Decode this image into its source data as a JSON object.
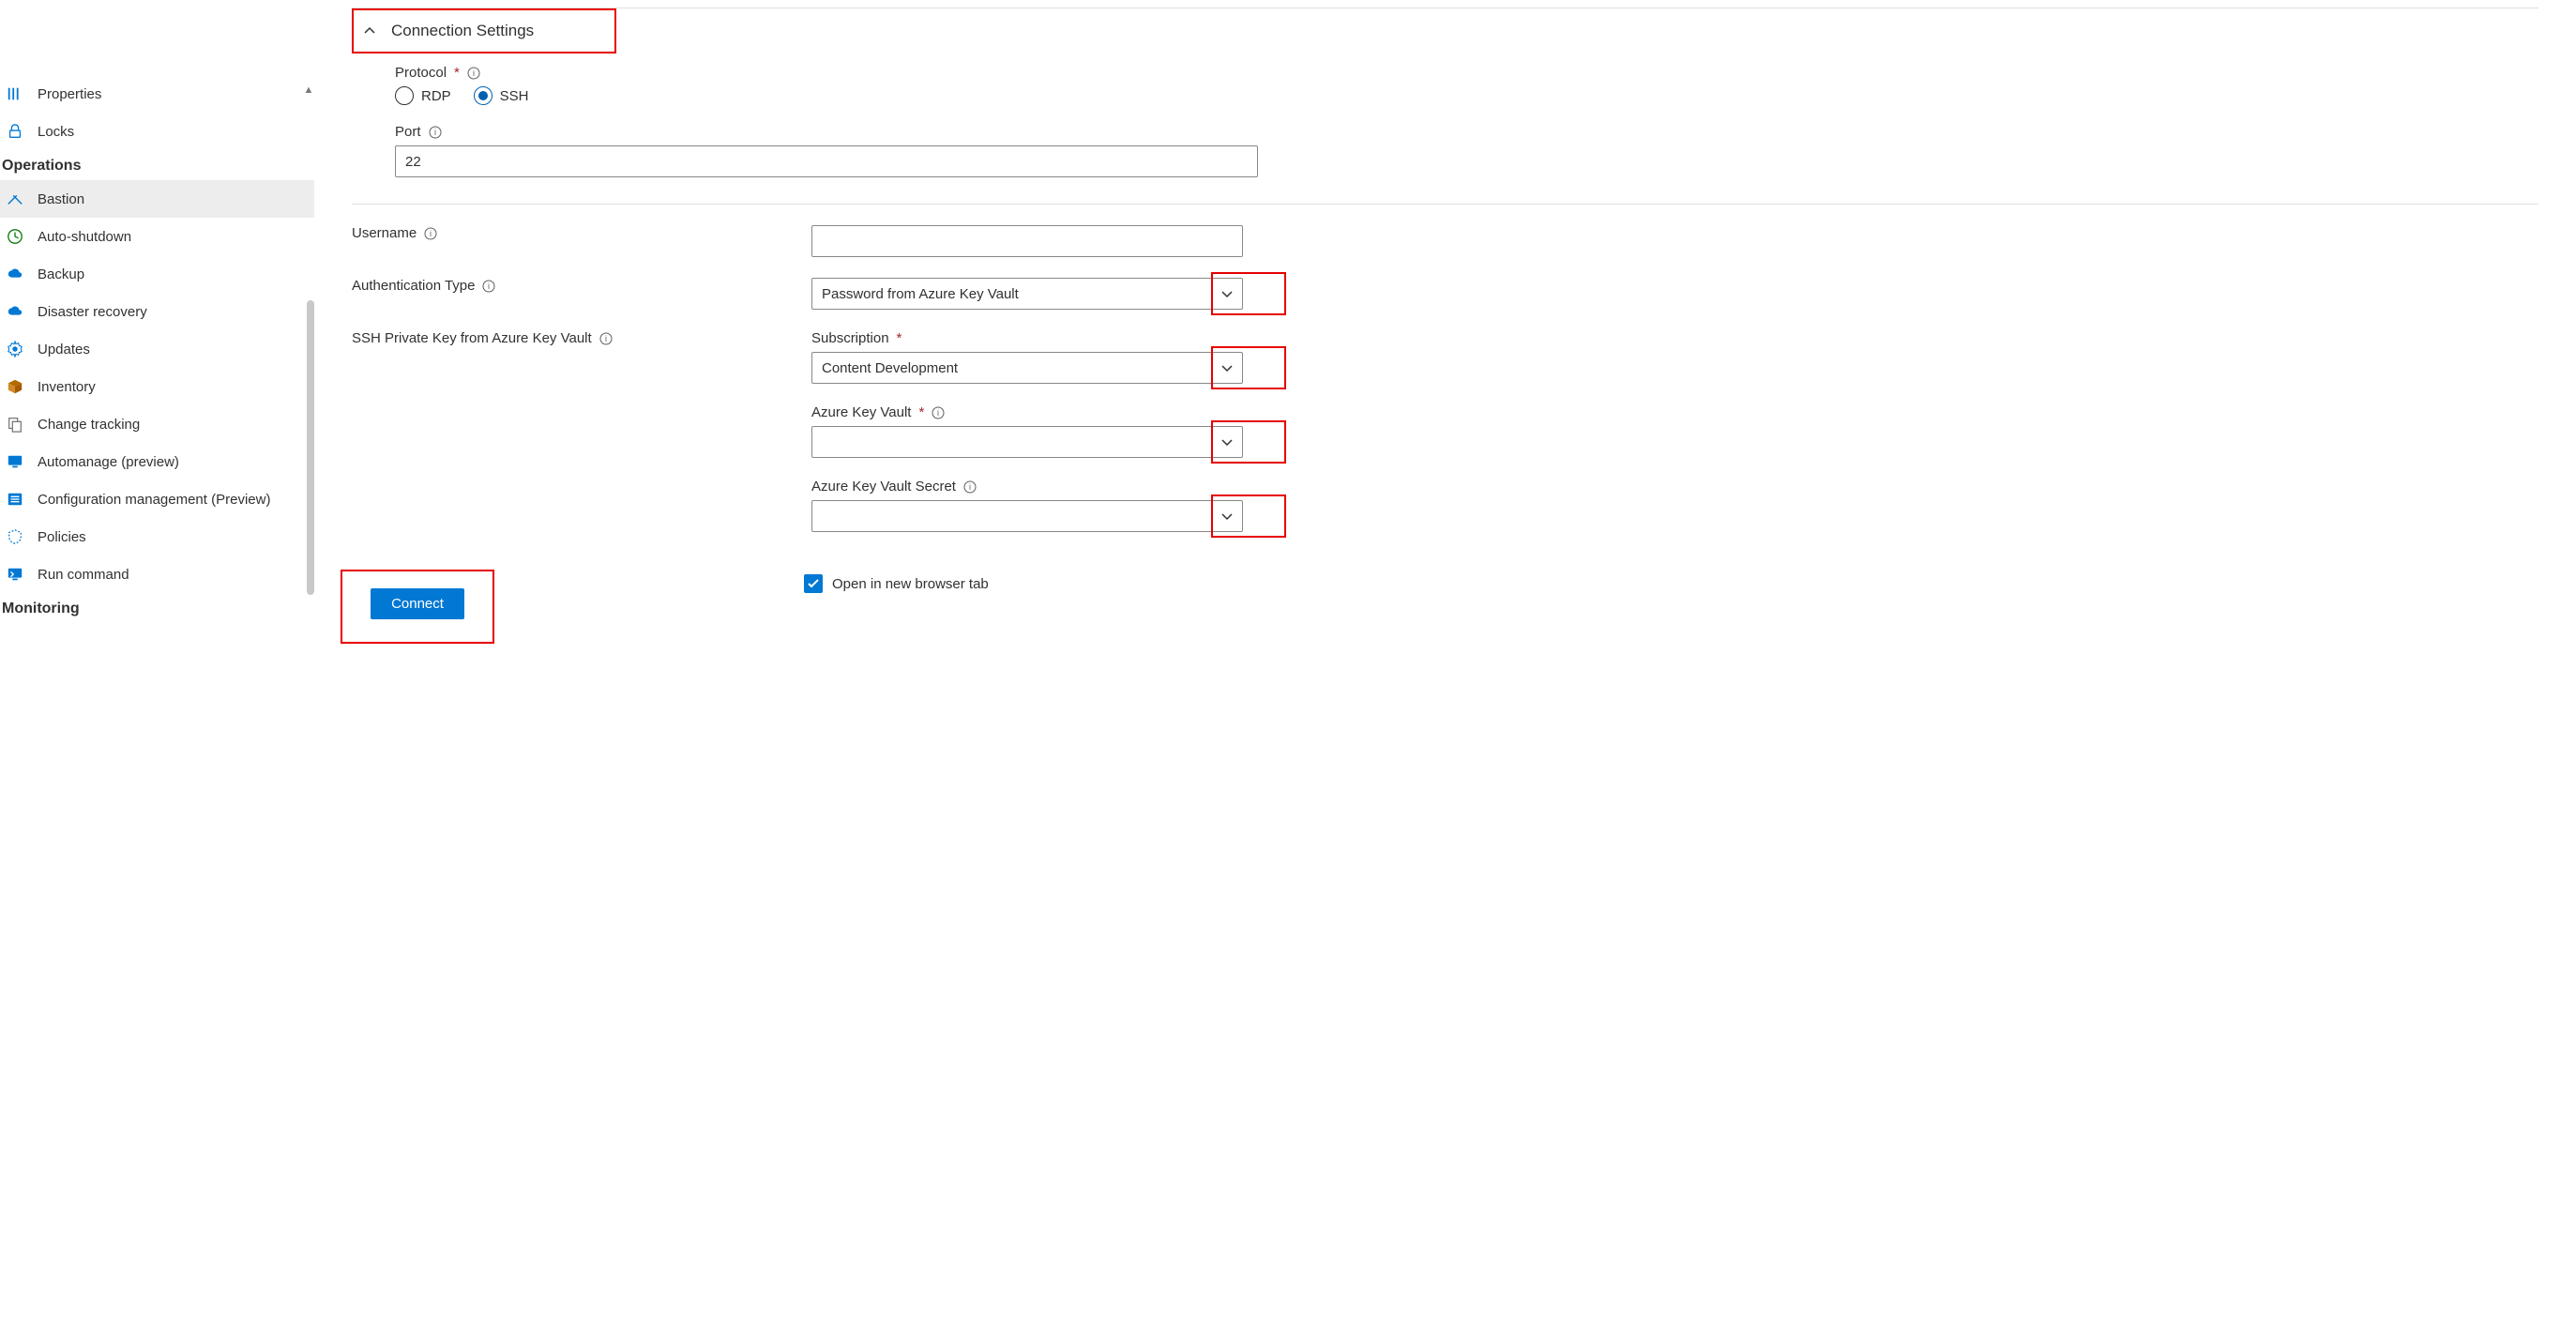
{
  "sidebar": {
    "sections": {
      "settings_items": [
        {
          "icon": "properties",
          "label": "Properties"
        },
        {
          "icon": "lock",
          "label": "Locks"
        }
      ],
      "operations_header": "Operations",
      "operations_items": [
        {
          "icon": "bastion",
          "label": "Bastion",
          "selected": true
        },
        {
          "icon": "clock",
          "label": "Auto-shutdown"
        },
        {
          "icon": "cloud",
          "label": "Backup"
        },
        {
          "icon": "cloud",
          "label": "Disaster recovery"
        },
        {
          "icon": "gear",
          "label": "Updates"
        },
        {
          "icon": "box",
          "label": "Inventory"
        },
        {
          "icon": "doc",
          "label": "Change tracking"
        },
        {
          "icon": "monitor",
          "label": "Automanage (preview)"
        },
        {
          "icon": "list",
          "label": "Configuration management (Preview)"
        },
        {
          "icon": "shield",
          "label": "Policies"
        },
        {
          "icon": "terminal",
          "label": "Run command"
        }
      ],
      "monitoring_header": "Monitoring"
    }
  },
  "settings": {
    "header": "Connection Settings",
    "protocol_label": "Protocol",
    "protocol_options": {
      "rdp": "RDP",
      "ssh": "SSH"
    },
    "protocol_selected": "ssh",
    "port_label": "Port",
    "port_value": "22"
  },
  "form": {
    "username_label": "Username",
    "username_value": "",
    "auth_type_label": "Authentication Type",
    "auth_type_value": "Password from Azure Key Vault",
    "ssh_kv_label": "SSH Private Key from Azure Key Vault",
    "subscription_label": "Subscription",
    "subscription_value": "Content Development",
    "akv_label": "Azure Key Vault",
    "akv_value": "",
    "secret_label": "Azure Key Vault Secret",
    "secret_value": ""
  },
  "footer": {
    "connect_label": "Connect",
    "open_tab_label": "Open in new browser tab",
    "open_tab_checked": true
  }
}
